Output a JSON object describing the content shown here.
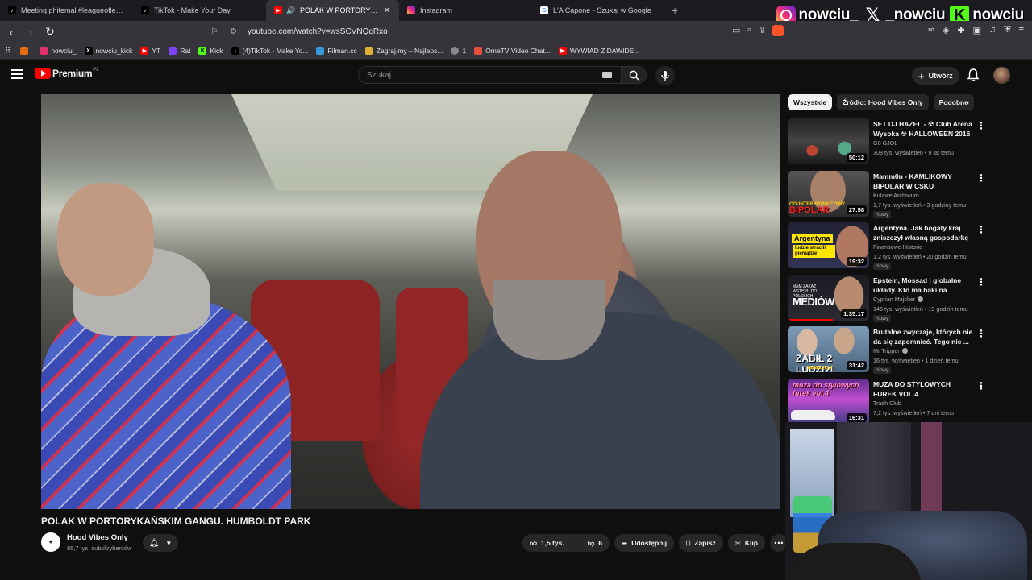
{
  "browser": {
    "tabs": [
      {
        "title": "Meeting phitemal #leagueoflegends",
        "favicon": "tiktok-icon",
        "color": "#000000"
      },
      {
        "title": "TikTok - Make Your Day",
        "favicon": "tiktok-icon",
        "color": "#000000"
      },
      {
        "title": "POLAK W PORTORYKAŃSKIM",
        "favicon": "youtube-icon",
        "color": "#ff0000",
        "active": true
      },
      {
        "title": "Instagram",
        "favicon": "instagram-icon",
        "color": "#e1306c"
      },
      {
        "title": "L'A Capone - Szukaj w Google",
        "favicon": "google-icon",
        "color": "#4285f4"
      }
    ],
    "new_tab_label": "+",
    "close_label": "✕",
    "url": "youtube.com/watch?v=wsSCVNQqRxo",
    "bookmarks": [
      {
        "label": "",
        "color": "#e86a10"
      },
      {
        "label": "nowciu_",
        "color": "#e1306c"
      },
      {
        "label": "nowciu_kick",
        "color": "#000000"
      },
      {
        "label": "YT",
        "color": "#ff0000"
      },
      {
        "label": "Rat",
        "color": "#7b42f6"
      },
      {
        "label": "Kick",
        "color": "#53fc18"
      },
      {
        "label": "(4)TikTok - Make Yo...",
        "color": "#000000"
      },
      {
        "label": "Filman.cc",
        "color": "#3a9ad9"
      },
      {
        "label": "Zagraj.my – Najleps...",
        "color": "#e0b030"
      },
      {
        "label": "1",
        "color": "#888888"
      },
      {
        "label": "OmeTV Video Chat...",
        "color": "#e74c3c"
      },
      {
        "label": "WYWIAD Z DAWIDE...",
        "color": "#ff0000"
      }
    ]
  },
  "overlay": {
    "instagram": "nowciu_",
    "x": "_nowciu",
    "kick": "nowciu",
    "x_glyph": "𝕏",
    "kick_glyph": "K"
  },
  "youtube": {
    "logo_text": "Premium",
    "logo_region": "PL",
    "search_placeholder": "Szukaj",
    "create_label": "Utwórz",
    "video": {
      "title": "POLAK W PORTORYKAŃSKIM GANGU. HUMBOLDT PARK",
      "channel": "Hood Vibes Only",
      "subscribers": "85,7 tys. subskrybentów",
      "likes": "1,5 tys.",
      "dislikes": "6",
      "share_label": "Udostępnij",
      "save_label": "Zapisz",
      "clip_label": "Klip"
    },
    "chips": [
      {
        "label": "Wszystkie",
        "active": true
      },
      {
        "label": "Źródło: Hood Vibes Only",
        "active": false
      },
      {
        "label": "Podobne",
        "active": false
      }
    ],
    "recommendations": [
      {
        "title": "SET DJ HAZEL - ☢ Club Arena Wysoka ☢  HALLOWEEN 2016 ...",
        "channel": "G0 GJOL",
        "meta": "308 tys. wyświetleń • 9 lat temu",
        "duration": "50:12",
        "badge": ""
      },
      {
        "title": "Mamm0n - KAMLIKOWY BIPOLAR W CSKU",
        "channel": "Kulawe Archiwum",
        "meta": "1,7 tys. wyświetleń • 3 godziny temu",
        "duration": "27:58",
        "badge": "Nowy",
        "thumb_top": "COUNTER STRIKE'OWY",
        "thumb_bottom": "BIPOLAR"
      },
      {
        "title": "Argentyna. Jak bogaty kraj zniszczył własną gospodarkę",
        "channel": "Finansowe Historie",
        "meta": "1,2 tys. wyświetleń • 20 godzin temu",
        "duration": "19:32",
        "badge": "Nowy",
        "thumb_top": "Argentyna",
        "thumb_bottom": "ludzie stracili pieniądze"
      },
      {
        "title": "Epstein, Mossad i globalne układy. Kto ma haki na polskie...",
        "channel": "Cyprian Majcher",
        "meta": "146 tys. wyświetleń • 19 godzin temu",
        "duration": "1:35:17",
        "badge": "Nowy",
        "verified": true,
        "thumb_top": "MAM ZAKAZ WSTĘPU DO POLSKICH",
        "thumb_bottom": "MEDIÓW"
      },
      {
        "title": "Brutalne zwyczaje, których nie da się zapomnieć. Tego nie ...",
        "channel": "Mr Tripper",
        "meta": "16 tys. wyświetleń • 1 dzień temu",
        "duration": "31:42",
        "badge": "Nowy",
        "verified": true,
        "thumb_top": "ZABIŁ 2 LUDZI?!",
        "thumb_bottom": "WENEZUELA"
      },
      {
        "title": "MUZA DO STYLOWYCH FUREK VOL.4",
        "channel": "Trash Club",
        "meta": "7,2 tys. wyświetleń • 7 dni temu",
        "duration": "16:31",
        "badge": "",
        "thumb_top": "muza do stylowych furek vol.4"
      }
    ]
  }
}
